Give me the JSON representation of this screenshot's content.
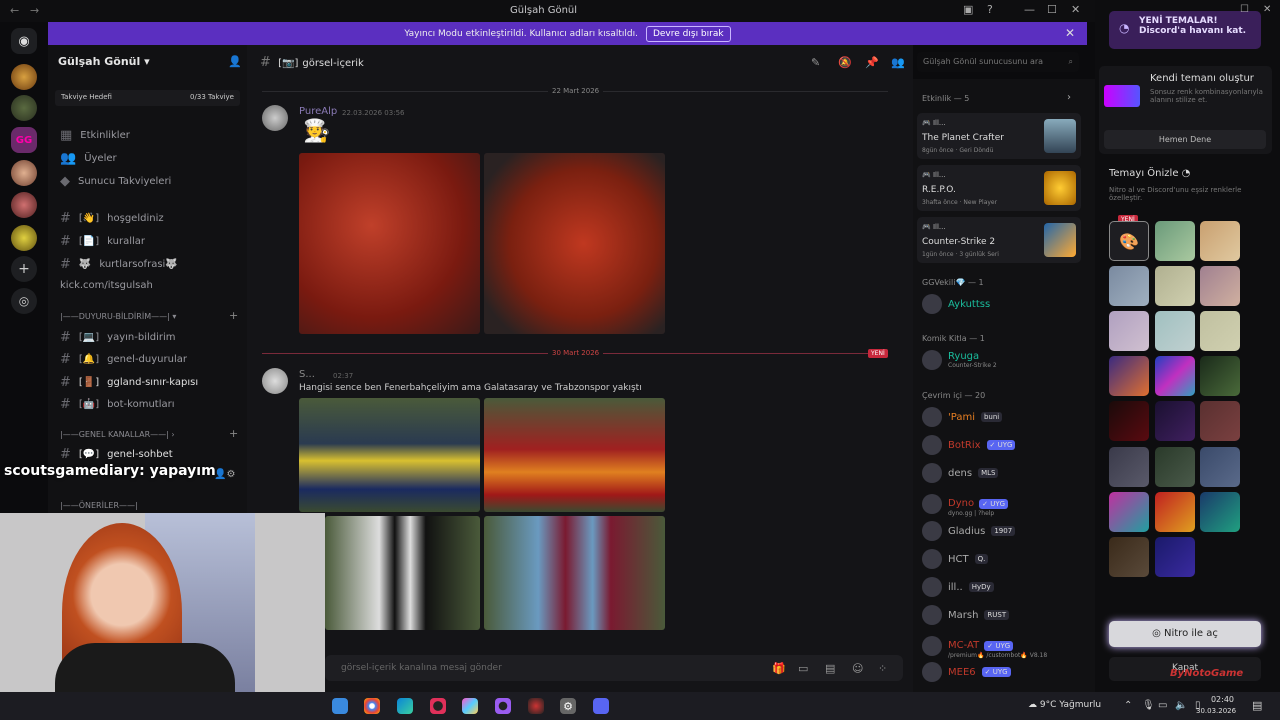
{
  "window": {
    "title": "Gülşah Gönül"
  },
  "notice": {
    "text": "Yayıncı Modu etkinleştirildi. Kullanıcı adları kısaltıldı.",
    "button": "Devre dışı bırak"
  },
  "server": {
    "name": "Gülşah Gönül",
    "boost_label": "Takviye Hedefi",
    "boost_count": "0/33 Takviye"
  },
  "nav": {
    "events": "Etkinlikler",
    "members": "Üyeler",
    "boosts": "Sunucu Takviyeleri"
  },
  "channels": [
    {
      "name": "hoşgeldiniz",
      "prefix": "[👋]"
    },
    {
      "name": "kurallar",
      "prefix": "[📄]"
    },
    {
      "name": "kurtlarsofrasi🐺",
      "prefix": "🐺"
    },
    {
      "name": "kick.com/itsgulsah",
      "prefix": ""
    },
    {
      "name": "yayın-bildirim",
      "prefix": "[💻]"
    },
    {
      "name": "genel-duyurular",
      "prefix": "[🔔]"
    },
    {
      "name": "ggland-sınır-kapısı",
      "prefix": "[🚪]"
    },
    {
      "name": "bot-komutları",
      "prefix": "[🤖]"
    },
    {
      "name": "genel-sohbet",
      "prefix": "[💬]"
    }
  ],
  "categories": {
    "announce": "|——DUYURU-BİLDİRİM——|",
    "general": "|——GENEL KANALLAR——|",
    "suggest": "|——ÖNERİLER——|"
  },
  "stream_overlay": {
    "user": "scoutsgamediary",
    "msg": ": yapayım"
  },
  "main": {
    "channel": "görsel-içerik",
    "channel_prefix": "[📷]",
    "search_placeholder": "Gülşah Gönül sunucusunu ara",
    "date1": "22 Mart 2026",
    "date2": "30 Mart 2026",
    "new": "YENİ",
    "composer": "görsel-içerik kanalına mesaj gönder"
  },
  "messages": [
    {
      "author": "PureAlp",
      "time": "22.03.2026 03:56",
      "text": "",
      "emoji": "🧑‍🍳"
    },
    {
      "author": "S...",
      "time": "02:37",
      "text": "Hangisi sence ben Fenerbahçeliyim ama Galatasaray ve Trabzonspor yakıştı"
    }
  ],
  "activity": {
    "title": "Etkinlik — 5",
    "cards": [
      {
        "game": "The Planet Crafter",
        "sub": "8gün önce · Geri Döndü"
      },
      {
        "game": "R.E.P.O.",
        "sub": "3hafta önce · New Player"
      },
      {
        "game": "Counter-Strike 2",
        "sub": "1gün önce · 3 günlük Seri"
      }
    ]
  },
  "member_groups": [
    {
      "title": "GGVekili💎 — 1",
      "members": [
        {
          "name": "Aykuttss",
          "color": "#1abc9c",
          "tag": "",
          "sub": ""
        }
      ]
    },
    {
      "title": "Komik Kitla — 1",
      "members": [
        {
          "name": "Ryuga",
          "color": "#1abc9c",
          "tag": "",
          "sub": "Counter-Strike 2"
        }
      ]
    },
    {
      "title": "Çevrim içi — 20",
      "members": [
        {
          "name": "'Pami",
          "color": "#e67e22",
          "tag": "buni",
          "sub": ""
        },
        {
          "name": "BotRix",
          "color": "#c0392b",
          "tag": "✓ UYG",
          "sub": ""
        },
        {
          "name": "dens",
          "color": "#aaaaaa",
          "tag": "MLS",
          "sub": ""
        },
        {
          "name": "Dyno",
          "color": "#c0392b",
          "tag": "✓ UYG",
          "sub": "dyno.gg | ?help"
        },
        {
          "name": "Gladius",
          "color": "#aaaaaa",
          "tag": "1907",
          "sub": ""
        },
        {
          "name": "HCT",
          "color": "#aaaaaa",
          "tag": "Q.",
          "sub": ""
        },
        {
          "name": "ill..",
          "color": "#aaaaaa",
          "tag": "HyDy",
          "sub": ""
        },
        {
          "name": "Marsh",
          "color": "#aaaaaa",
          "tag": "RUST",
          "sub": ""
        },
        {
          "name": "MC-AT",
          "color": "#c0392b",
          "tag": "✓ UYG",
          "sub": "/premium🔥 /custombot🔥 V8.18"
        },
        {
          "name": "MEE6",
          "color": "#c0392b",
          "tag": "✓ UYG",
          "sub": ""
        }
      ]
    }
  ],
  "theme_panel": {
    "promo_title": "YENİ TEMALAR!",
    "promo_sub": "Discord'a havanı kat.",
    "create_title": "Kendi temanı oluştur",
    "create_sub": "Sonsuz renk kombinasyonlarıyla alanını stilize et.",
    "try_btn": "Hemen Dene",
    "preview_title": "Temayı Önizle",
    "preview_sub": "Nitro al ve Discord'unu eşsiz renklerle özelleştir.",
    "new_badge": "YENİ",
    "nitro_btn": "Nitro ile aç",
    "close_btn": "Kapat"
  },
  "taskbar": {
    "weather": "9°C Yağmurlu",
    "time": "02:40",
    "date": "30.03.2026"
  },
  "watermark": "ByNotoGame"
}
